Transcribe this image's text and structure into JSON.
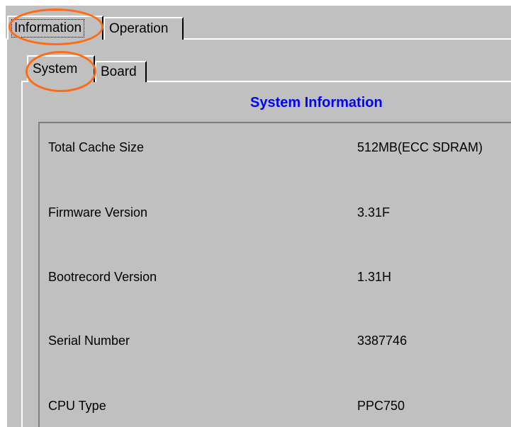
{
  "tabs": {
    "outer": [
      "Information",
      "Operation"
    ],
    "inner": [
      "System",
      "Board"
    ]
  },
  "section_title": "System Information",
  "rows": [
    {
      "label": "Total Cache Size",
      "value": "512MB(ECC SDRAM)"
    },
    {
      "label": "Firmware Version",
      "value": "3.31F"
    },
    {
      "label": "Bootrecord Version",
      "value": "1.31H"
    },
    {
      "label": "Serial Number",
      "value": "3387746"
    },
    {
      "label": "CPU Type",
      "value": "PPC750"
    }
  ],
  "colors": {
    "background": "#c0c0c0",
    "title": "#0000ff",
    "highlight": "#ff6a13"
  }
}
